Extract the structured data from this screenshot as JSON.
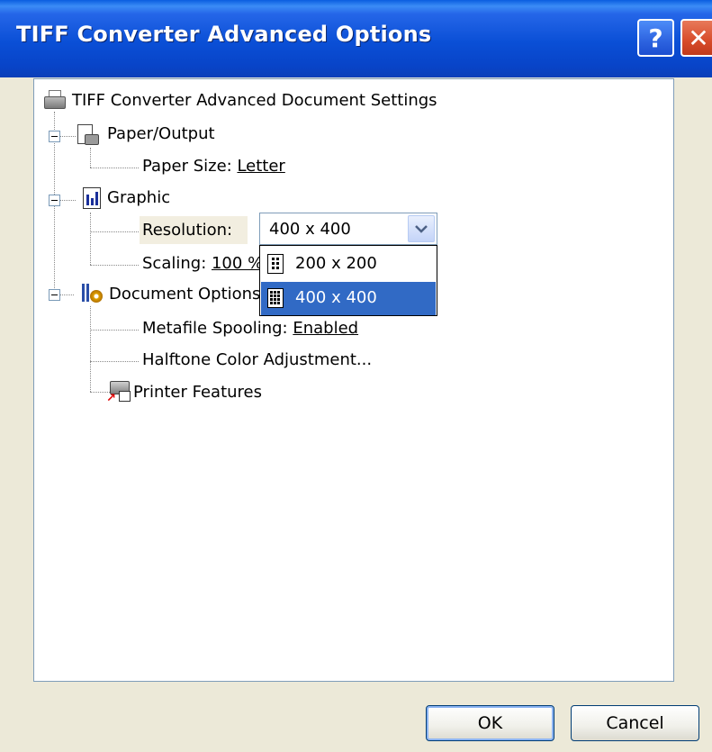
{
  "window": {
    "title": "TIFF Converter Advanced Options",
    "help_label": "?",
    "close_label": "✕"
  },
  "tree": {
    "root": {
      "label": "TIFF Converter Advanced Document Settings",
      "icon": "printer-icon"
    },
    "paper": {
      "label": "Paper/Output",
      "icon": "page-printer-icon",
      "paper_size": {
        "label": "Paper Size: ",
        "value": "Letter"
      }
    },
    "graphic": {
      "label": "Graphic",
      "icon": "graphic-icon",
      "resolution": {
        "label": "Resolution:",
        "value": "400 x 400"
      },
      "scaling": {
        "label": "Scaling: ",
        "value": "100 %"
      }
    },
    "document_options": {
      "label": "Document Options",
      "icon": "document-options-icon",
      "metafile": {
        "label": "Metafile Spooling: ",
        "value": "Enabled"
      },
      "halftone": {
        "label": "Halftone Color Adjustment..."
      },
      "printer_features": {
        "label": "Printer Features",
        "icon": "printer-features-icon"
      }
    }
  },
  "dropdown": {
    "options": [
      {
        "label": "200 x 200",
        "selected": false
      },
      {
        "label": "400 x 400",
        "selected": true
      }
    ],
    "selection_color": "#316ac5"
  },
  "buttons": {
    "ok": "OK",
    "cancel": "Cancel"
  }
}
